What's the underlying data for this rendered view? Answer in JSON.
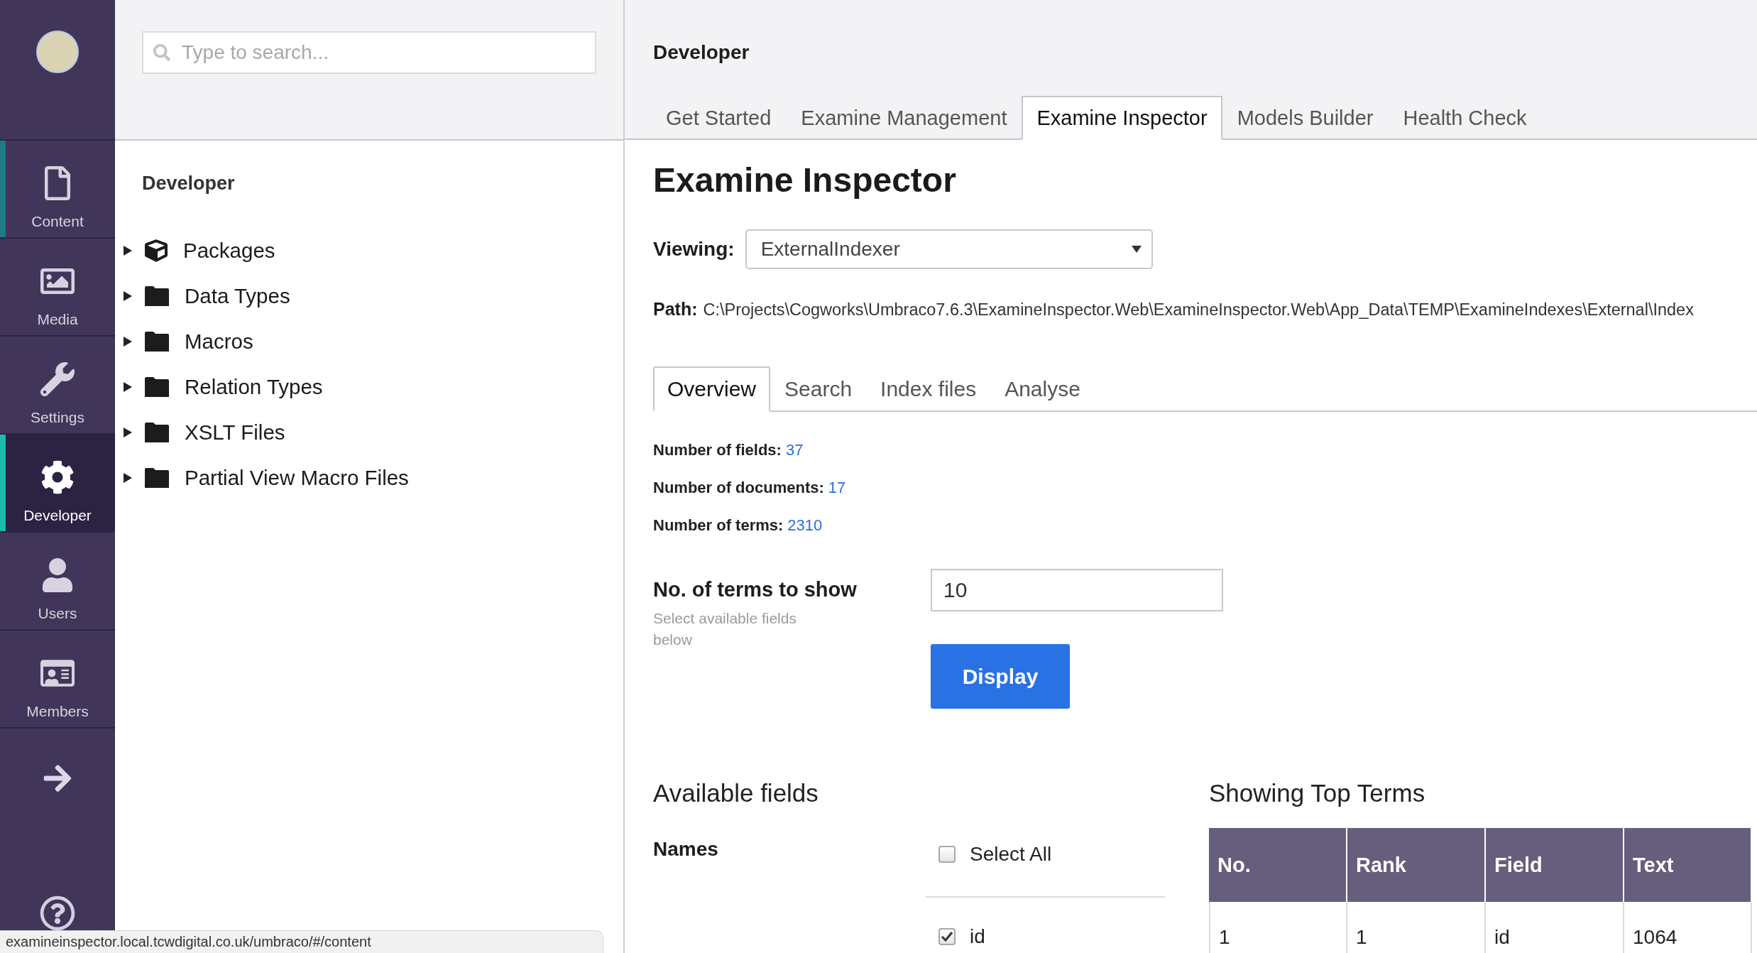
{
  "sidebar": {
    "items": [
      {
        "label": "Content",
        "selected": false,
        "highlighted": true
      },
      {
        "label": "Media",
        "selected": false,
        "highlighted": false
      },
      {
        "label": "Settings",
        "selected": false,
        "highlighted": false
      },
      {
        "label": "Developer",
        "selected": true,
        "highlighted": false
      },
      {
        "label": "Users",
        "selected": false,
        "highlighted": false
      },
      {
        "label": "Members",
        "selected": false,
        "highlighted": false
      }
    ]
  },
  "tree": {
    "search": {
      "placeholder": "Type to search..."
    },
    "heading": "Developer",
    "items": [
      {
        "label": "Packages",
        "kind": "package",
        "expanded": false
      },
      {
        "label": "Data Types",
        "kind": "folder",
        "expanded": false
      },
      {
        "label": "Macros",
        "kind": "folder",
        "expanded": false
      },
      {
        "label": "Relation Types",
        "kind": "folder",
        "expanded": false
      },
      {
        "label": "XSLT Files",
        "kind": "folder",
        "expanded": false
      },
      {
        "label": "Partial View Macro Files",
        "kind": "folder",
        "expanded": false
      }
    ]
  },
  "header": {
    "title": "Developer",
    "tabs": [
      {
        "label": "Get Started",
        "selected": false
      },
      {
        "label": "Examine Management",
        "selected": false
      },
      {
        "label": "Examine Inspector",
        "selected": true
      },
      {
        "label": "Models Builder",
        "selected": false
      },
      {
        "label": "Health Check",
        "selected": false
      }
    ]
  },
  "page": {
    "title": "Examine Inspector",
    "viewing": {
      "label": "Viewing:",
      "value": "ExternalIndexer"
    },
    "path": {
      "label": "Path:",
      "value": "C:\\Projects\\Cogworks\\Umbraco7.6.3\\ExamineInspector.Web\\ExamineInspector.Web\\App_Data\\TEMP\\ExamineIndexes\\External\\Index"
    },
    "subtabs": [
      {
        "label": "Overview",
        "selected": true
      },
      {
        "label": "Search",
        "selected": false
      },
      {
        "label": "Index files",
        "selected": false
      },
      {
        "label": "Analyse",
        "selected": false
      }
    ],
    "stats": [
      {
        "label": "Number of fields:",
        "value": "37"
      },
      {
        "label": "Number of documents:",
        "value": "17"
      },
      {
        "label": "Number of terms:",
        "value": "2310"
      }
    ],
    "terms_to_show": {
      "label": "No. of terms to show",
      "description": "Select available fields below",
      "value": "10"
    },
    "display_button": "Display",
    "available_fields": {
      "title": "Available fields",
      "names_label": "Names",
      "select_all": {
        "label": "Select All",
        "checked": false
      },
      "fields": [
        {
          "label": "id",
          "checked": true
        }
      ]
    },
    "top_terms": {
      "title": "Showing Top Terms",
      "columns": [
        "No.",
        "Rank",
        "Field",
        "Text"
      ],
      "rows": [
        [
          "1",
          "1",
          "id",
          "1064"
        ]
      ]
    }
  },
  "status_bar": {
    "url": "examineinspector.local.tcwdigital.co.uk/umbraco/#/content"
  }
}
